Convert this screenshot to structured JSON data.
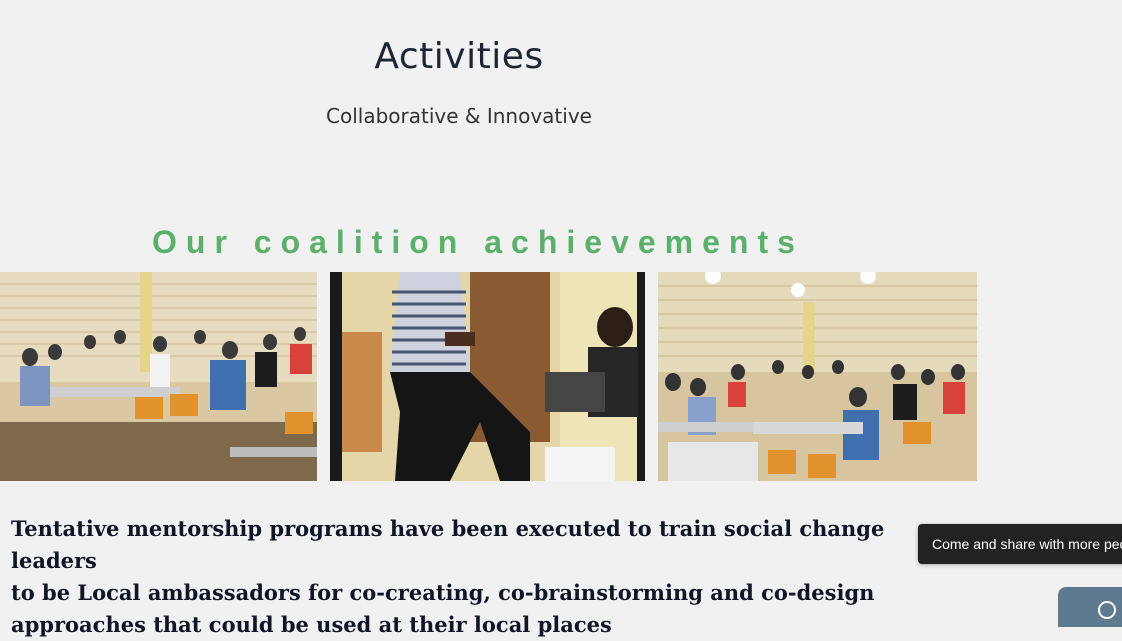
{
  "hero": {
    "title": "Activities",
    "subtitle": "Collaborative & Innovative"
  },
  "section": {
    "heading": "Our coalition achievements"
  },
  "gallery": {
    "photos": [
      {
        "alt": "Mentorship classroom photo 1"
      },
      {
        "alt": "Mentorship classroom photo 2"
      },
      {
        "alt": "Mentorship classroom photo 3"
      }
    ]
  },
  "body": {
    "text": "Tentative mentorship programs have been executed to train social change leaders\nto be Local ambassadors for co-creating, co-brainstorming and co-design\n approaches that could be used at their local places"
  },
  "tooltip": {
    "text": "Come and share with more people"
  },
  "colors": {
    "background": "#f1f1f1",
    "heading_green": "#5bb06c",
    "title_dark": "#1c2533",
    "tooltip_bg": "#222222",
    "chat_widget": "#5e7a8f"
  },
  "icons": {
    "chat": "chat-icon"
  }
}
